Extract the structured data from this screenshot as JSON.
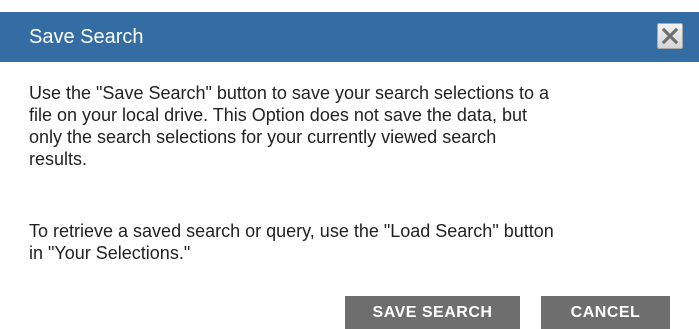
{
  "dialog": {
    "title": "Save Search",
    "close_icon": "close-icon",
    "paragraph_1": "Use the \"Save Search\" button to save your search selections to a\nfile on your local drive. This Option does not save the data, but\nonly the search selections for your currently viewed search\nresults.",
    "paragraph_2": "To retrieve a saved search or query, use the \"Load Search\" button\nin \"Your Selections.\"",
    "save_button_label": "SAVE SEARCH",
    "cancel_button_label": "CANCEL"
  },
  "colors": {
    "titlebar": "#346da3",
    "button": "#6e6e6e",
    "text": "#222222"
  }
}
